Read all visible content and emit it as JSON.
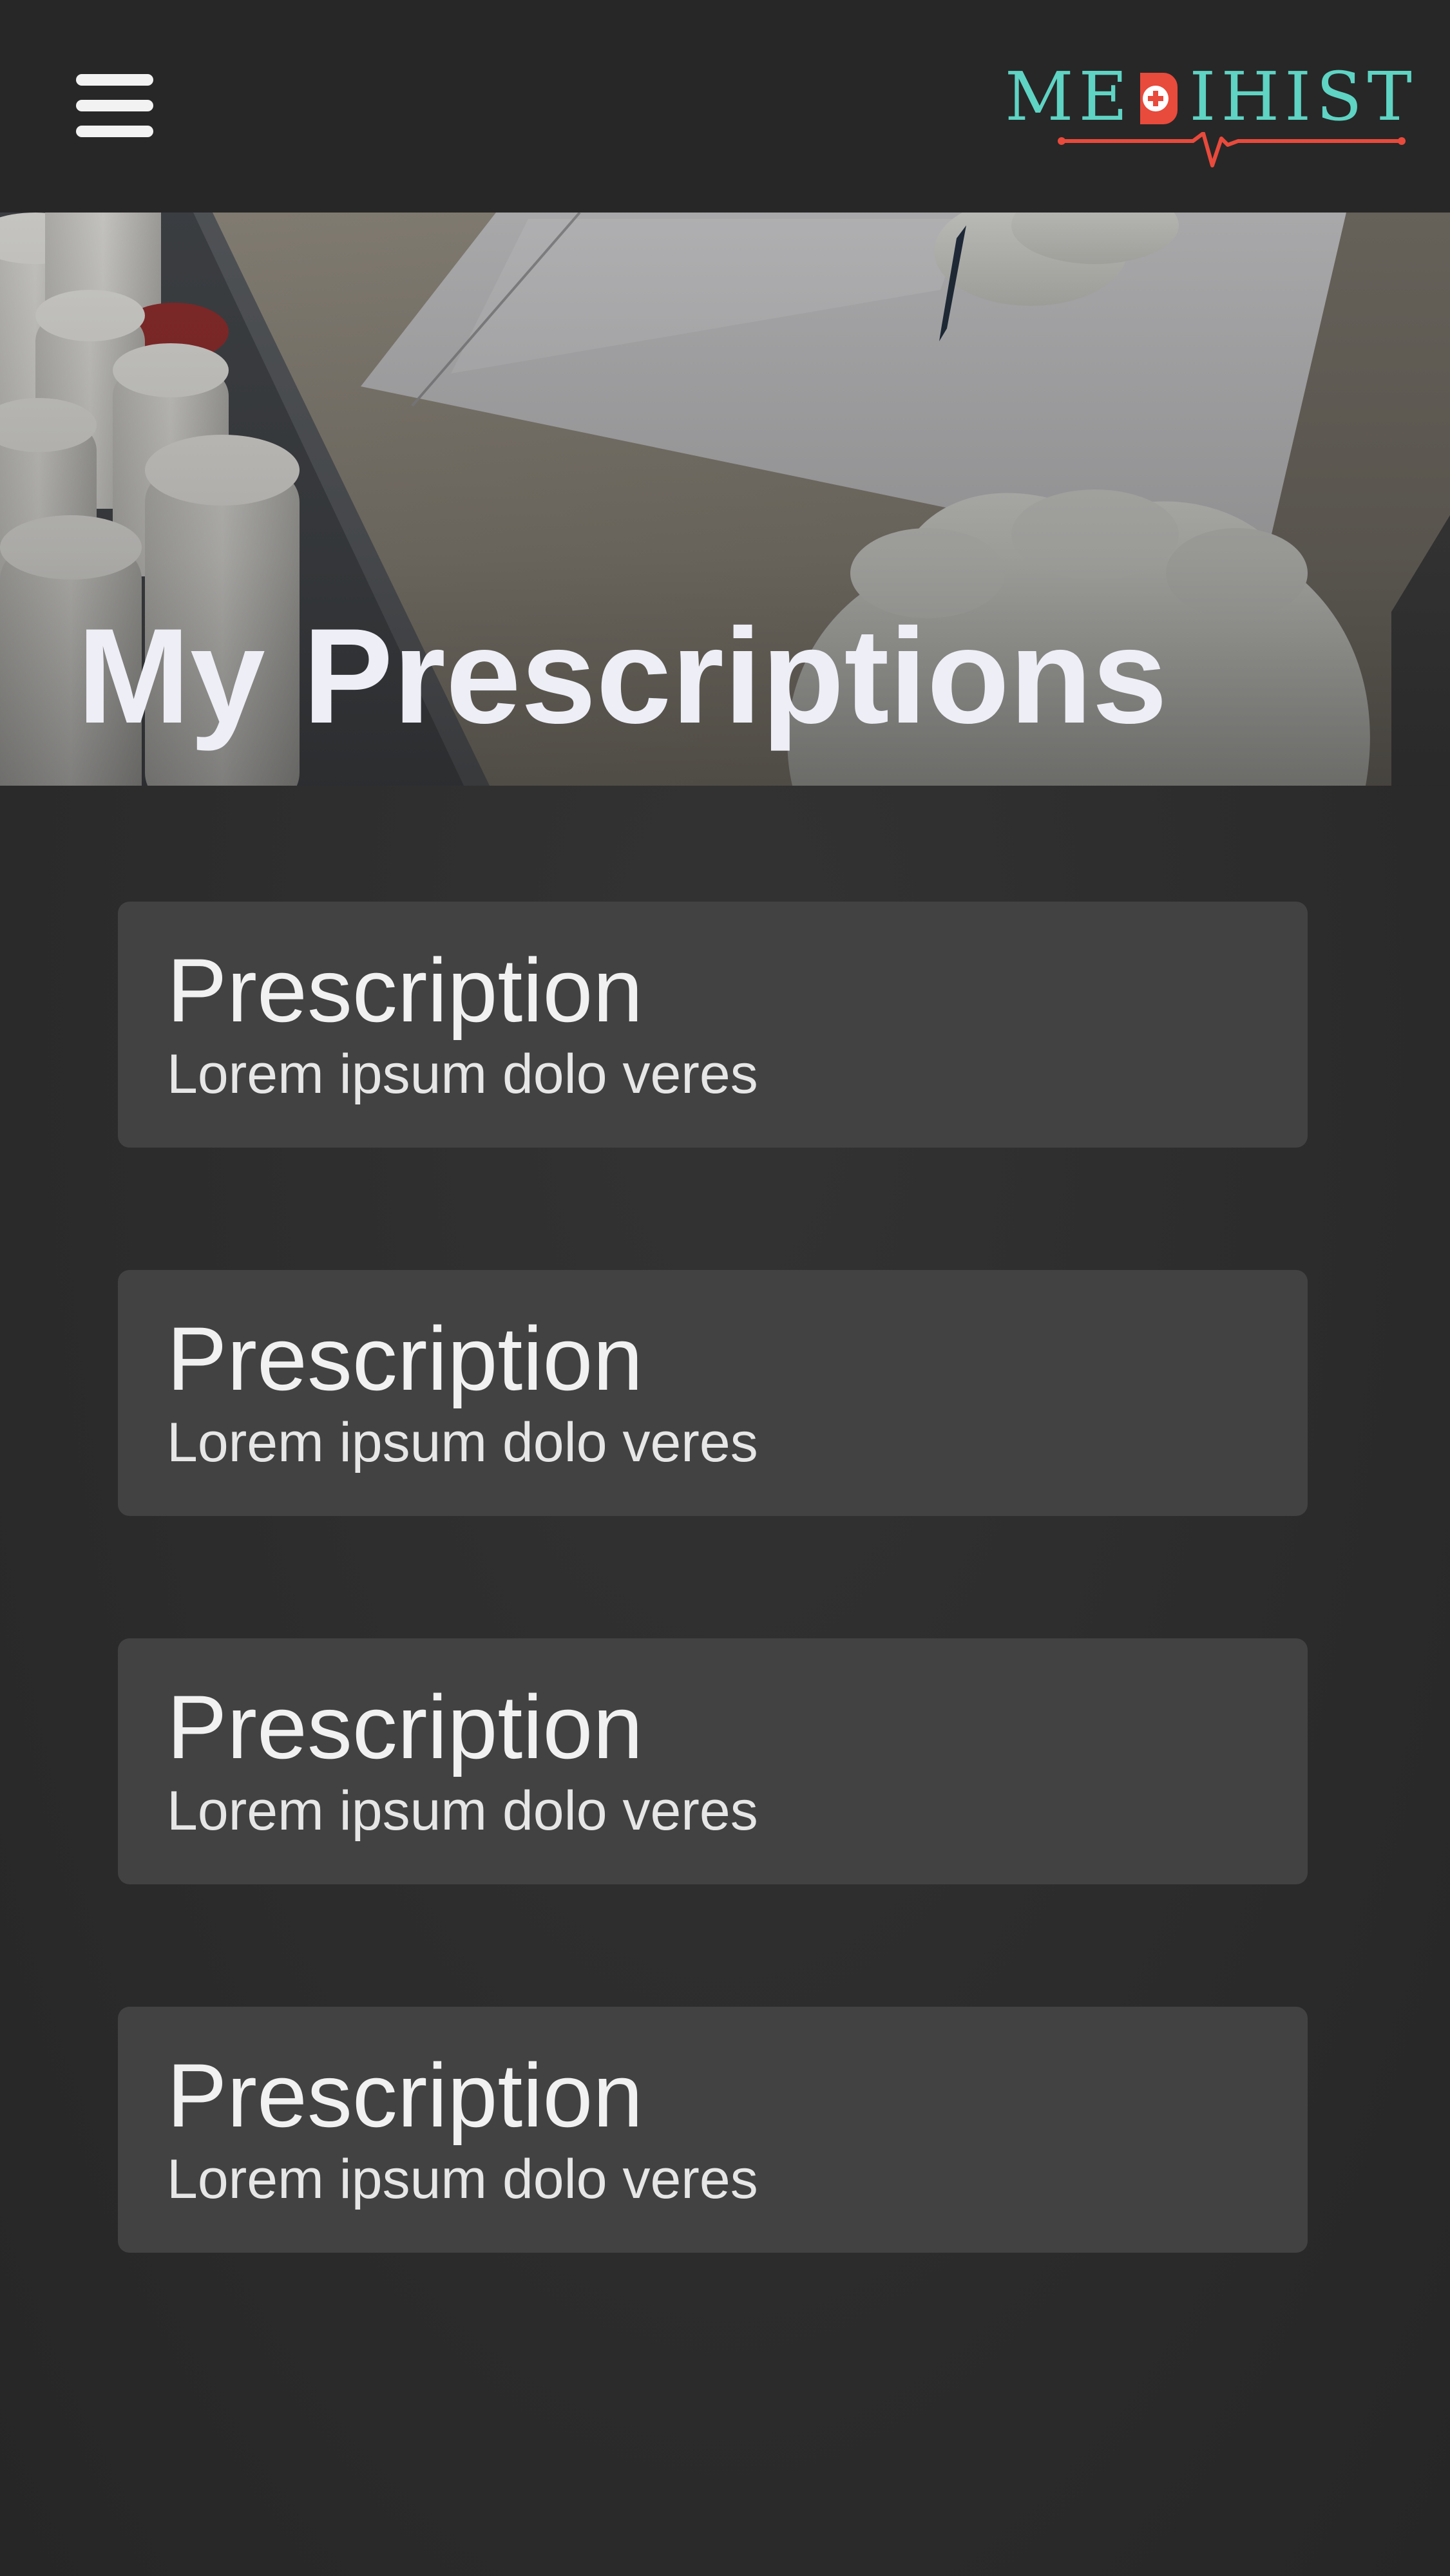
{
  "header": {
    "menu_icon": "hamburger-menu-icon",
    "logo": {
      "text_left": "ME",
      "text_right": "IHIST",
      "badge_icon": "medical-cross-badge-icon",
      "pulse_icon": "heartbeat-line-icon",
      "color_text": "#5fd3c4",
      "color_accent": "#e84a3c"
    }
  },
  "hero": {
    "title": "My Prescriptions",
    "image": "prescription-writing-photo"
  },
  "prescriptions": [
    {
      "title": "Prescription",
      "subtitle": "Lorem ipsum dolo veres"
    },
    {
      "title": "Prescription",
      "subtitle": "Lorem ipsum dolo veres"
    },
    {
      "title": "Prescription",
      "subtitle": "Lorem ipsum dolo veres"
    },
    {
      "title": "Prescription",
      "subtitle": "Lorem ipsum dolo veres"
    }
  ],
  "colors": {
    "background": "#2b2b2b",
    "topbar": "#272727",
    "card": "#424242",
    "text": "#f1f1f1"
  }
}
